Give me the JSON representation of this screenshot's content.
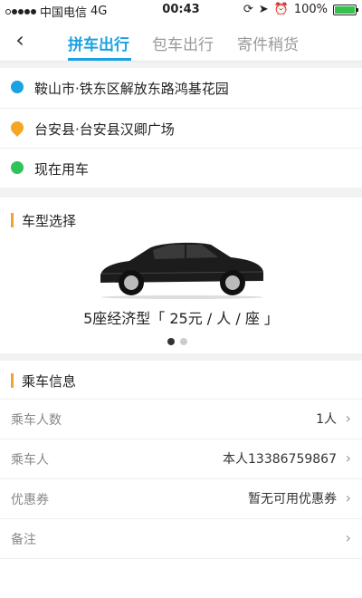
{
  "status": {
    "carrier": "中国电信",
    "network": "4G",
    "time": "00:43",
    "battery": "100%",
    "battery_level": 1.0
  },
  "nav": {
    "back_icon": "chevron-left-icon",
    "tabs": [
      {
        "label": "拼车出行",
        "active": true
      },
      {
        "label": "包车出行",
        "active": false
      },
      {
        "label": "寄件稍货",
        "active": false
      }
    ]
  },
  "route": {
    "from": "鞍山市·铁东区解放东路鸿基花园",
    "to": "台安县·台安县汉卿广场",
    "when": "现在用车"
  },
  "car": {
    "section_title": "车型选择",
    "description": "5座经济型「 25元 / 人 / 座 」",
    "carousel_pages": 2,
    "carousel_active": 1
  },
  "passenger": {
    "section_title": "乘车信息",
    "rows": [
      {
        "label": "乘车人数",
        "value": "1人"
      },
      {
        "label": "乘车人",
        "value": "本人13386759867"
      },
      {
        "label": "优惠券",
        "value": "暂无可用优惠券"
      },
      {
        "label": "备注",
        "value": ""
      }
    ]
  },
  "colors": {
    "accent": "#1aa2e3",
    "section_marker": "#f0a330",
    "start_marker": "#1aa2e3",
    "end_marker": "#f5a623",
    "now_marker": "#2ec45a"
  }
}
